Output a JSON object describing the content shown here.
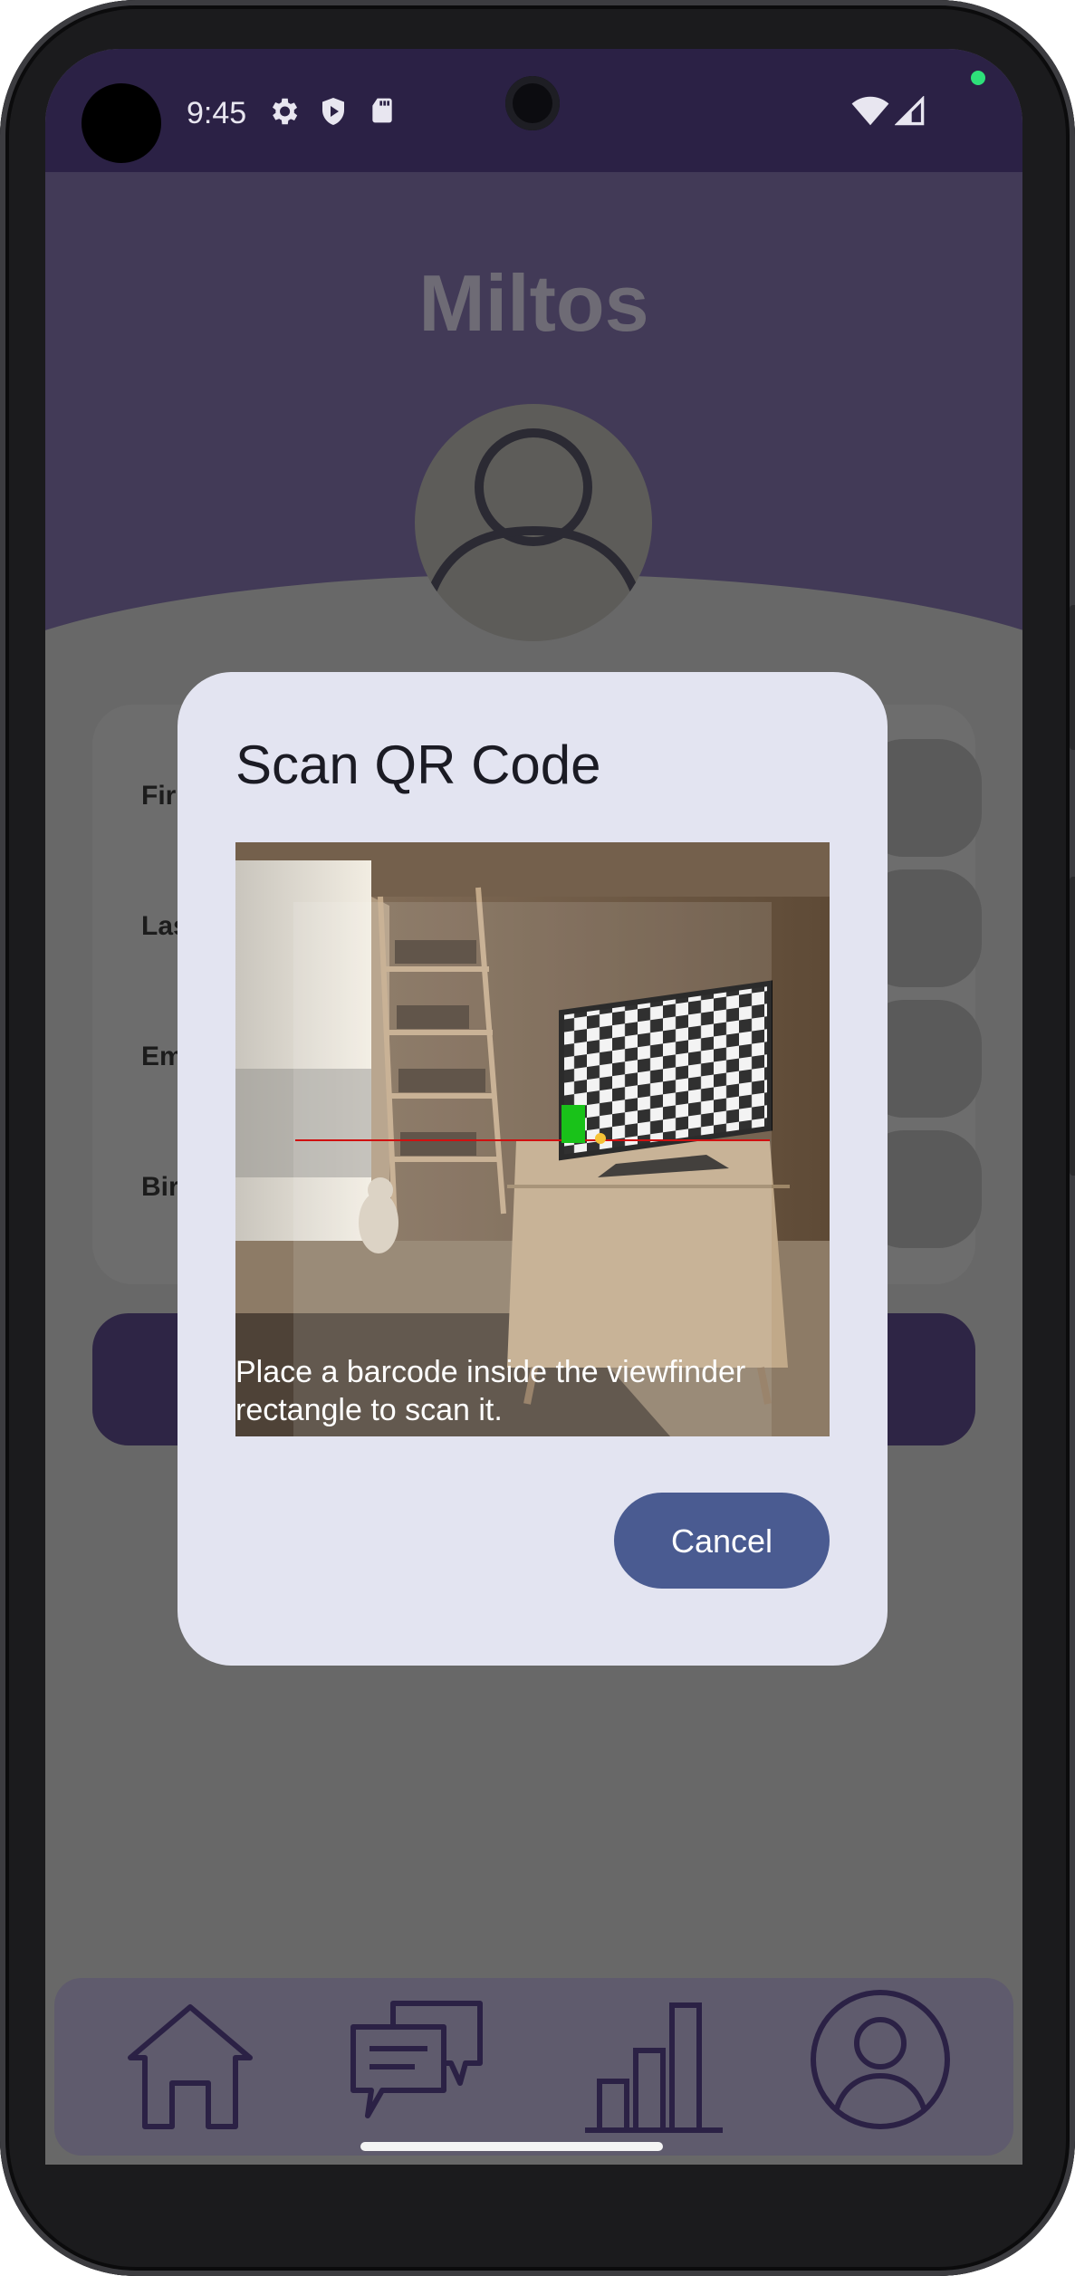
{
  "status_bar": {
    "time": "9:45",
    "left_icons": [
      "gear-icon",
      "shield-play-icon",
      "sd-card-icon"
    ],
    "right_icons": [
      "wifi-icon",
      "cellular-signal-icon"
    ]
  },
  "app": {
    "title": "Miltos",
    "fields": [
      {
        "label_visible": "Fir"
      },
      {
        "label_visible": "Las"
      },
      {
        "label_visible": "Em"
      },
      {
        "label_visible": "Bir"
      }
    ]
  },
  "dialog": {
    "title": "Scan QR Code",
    "hint": "Place a barcode inside the viewfinder rectangle to scan it.",
    "cancel_label": "Cancel"
  },
  "bottom_nav": {
    "items": [
      "home-icon",
      "chat-icon",
      "chart-icon",
      "profile-icon"
    ]
  },
  "colors": {
    "status_bar": "#2b2145",
    "header_purple": "#423a57",
    "dialog_bg": "#e3e4f1",
    "cancel_button": "#4a5b91",
    "scan_line": "#d01010",
    "focus_marker": "#19c219"
  }
}
